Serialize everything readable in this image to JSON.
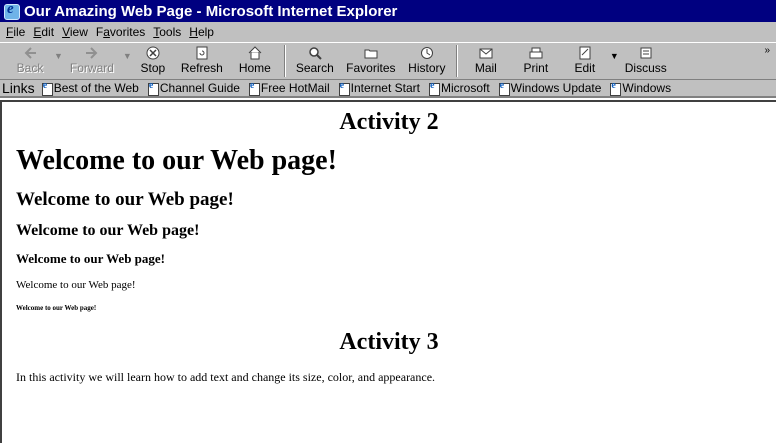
{
  "window": {
    "title": "Our Amazing Web Page - Microsoft Internet Explorer"
  },
  "menubar": {
    "items": [
      {
        "label": "File",
        "accel": "F",
        "rest": "ile"
      },
      {
        "label": "Edit",
        "accel": "E",
        "rest": "dit"
      },
      {
        "label": "View",
        "accel": "V",
        "rest": "iew"
      },
      {
        "label": "Favorites",
        "pre": "F",
        "accel": "a",
        "rest": "vorites"
      },
      {
        "label": "Tools",
        "accel": "T",
        "rest": "ools"
      },
      {
        "label": "Help",
        "accel": "H",
        "rest": "elp"
      }
    ]
  },
  "toolbar": {
    "back": "Back",
    "forward": "Forward",
    "stop": "Stop",
    "refresh": "Refresh",
    "home": "Home",
    "search": "Search",
    "favorites": "Favorites",
    "history": "History",
    "mail": "Mail",
    "print": "Print",
    "edit": "Edit",
    "discuss": "Discuss",
    "more": "»"
  },
  "links": {
    "label": "Links",
    "items": [
      "Best of the Web",
      "Channel Guide",
      "Free HotMail",
      "Internet Start",
      "Microsoft",
      "Windows Update",
      "Windows"
    ]
  },
  "page": {
    "activity2": "Activity 2",
    "heading1": "Welcome to our Web page!",
    "heading2": "Welcome to our Web page!",
    "heading3": "Welcome to our Web page!",
    "heading4": "Welcome to our Web page!",
    "heading5": "Welcome to our Web page!",
    "heading6": "Welcome to our Web page!",
    "activity3": "Activity 3",
    "paragraph": "In this activity we will learn how to add text and change its size, color, and appearance."
  }
}
